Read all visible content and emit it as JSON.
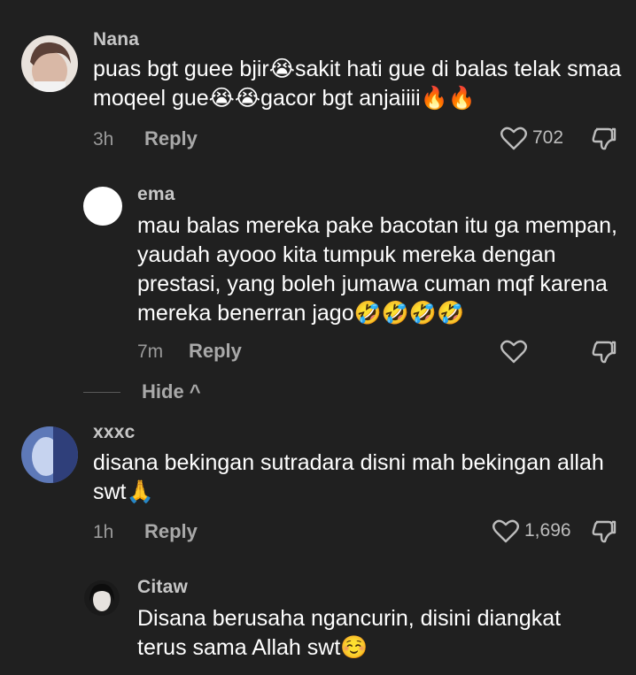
{
  "comments": [
    {
      "username": "Nana",
      "text": "puas bgt guee bjir😭sakit hati gue di balas telak smaa moqeel gue😭😭gacor bgt anjaiiii🔥🔥",
      "time": "3h",
      "reply_label": "Reply",
      "likes": "702"
    },
    {
      "username": "ema",
      "text": "mau balas mereka pake bacotan itu ga mempan, yaudah ayooo kita tumpuk mereka dengan prestasi, yang boleh jumawa cuman mqf karena mereka benerran jago🤣🤣🤣🤣",
      "time": "7m",
      "reply_label": "Reply",
      "likes": ""
    },
    {
      "username": "xxxc",
      "text": "disana bekingan sutradara disni mah bekingan allah swt🙏",
      "time": "1h",
      "reply_label": "Reply",
      "likes": "1,696"
    },
    {
      "username": "Citaw",
      "text": "Disana berusaha ngancurin, disini diangkat terus sama Allah swt☺️",
      "time": "",
      "reply_label": "",
      "likes": ""
    }
  ],
  "hide_label": "Hide ^",
  "icons": {
    "like": "heart-outline-icon",
    "dislike": "thumbs-down-icon",
    "collapse": "chevron-up-icon"
  },
  "colors": {
    "background": "#202020",
    "text": "#ffffff",
    "secondary": "#a9a9a9"
  }
}
